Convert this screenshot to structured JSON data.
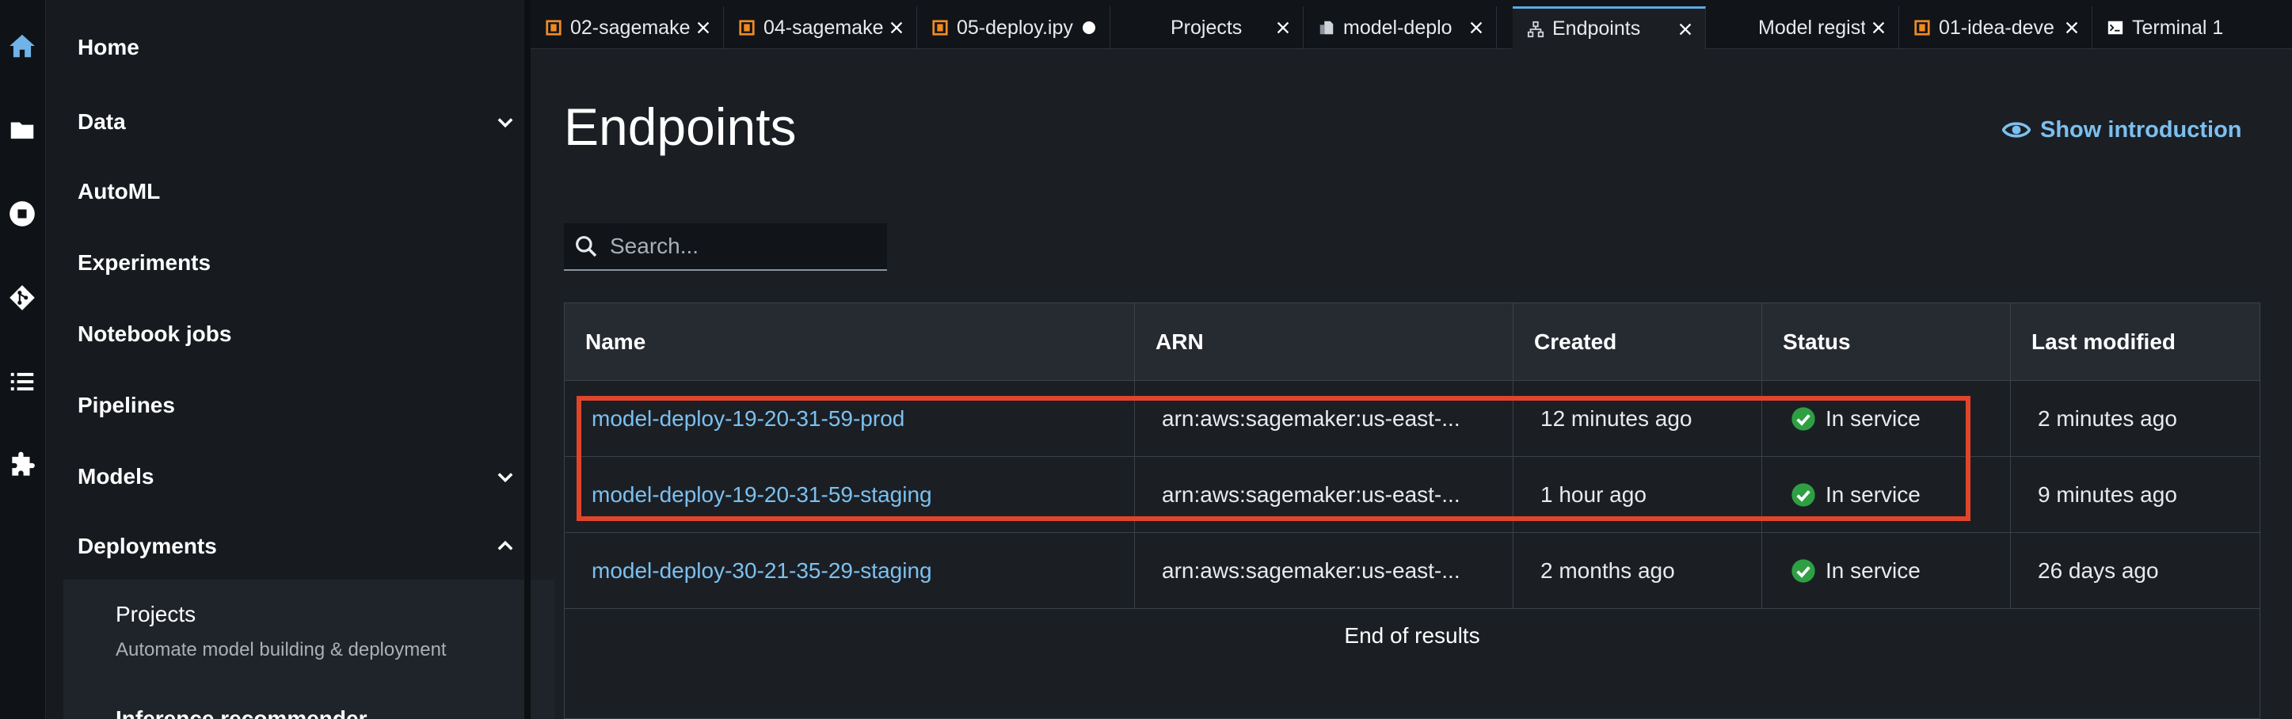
{
  "rail": {
    "icons": [
      "home-icon",
      "folder-icon",
      "stop-circle-icon",
      "git-icon",
      "list-icon",
      "extension-icon"
    ]
  },
  "sidebar": {
    "items": [
      {
        "label": "Home"
      },
      {
        "label": "Data"
      },
      {
        "label": "AutoML"
      },
      {
        "label": "Experiments"
      },
      {
        "label": "Notebook jobs"
      },
      {
        "label": "Pipelines"
      },
      {
        "label": "Models"
      },
      {
        "label": "Deployments"
      }
    ],
    "sub": {
      "title": "Projects",
      "description": "Automate model building & deployment",
      "next": "Inference recommender"
    }
  },
  "tabs": [
    {
      "label": "02-sagemake"
    },
    {
      "label": "04-sagemake"
    },
    {
      "label": "05-deploy.ipy"
    },
    {
      "label": "Projects"
    },
    {
      "label": "model-deplo"
    },
    {
      "label": "Endpoints"
    },
    {
      "label": "Model registr"
    },
    {
      "label": "01-idea-deve"
    },
    {
      "label": "Terminal 1"
    }
  ],
  "main": {
    "title": "Endpoints",
    "show_intro": "Show introduction",
    "search_placeholder": "Search..."
  },
  "table": {
    "columns": [
      "Name",
      "ARN",
      "Created",
      "Status",
      "Last modified"
    ],
    "rows": [
      {
        "name": "model-deploy-19-20-31-59-prod",
        "arn": "arn:aws:sagemaker:us-east-...",
        "created": "12 minutes ago",
        "status": "In service",
        "modified": "2 minutes ago"
      },
      {
        "name": "model-deploy-19-20-31-59-staging",
        "arn": "arn:aws:sagemaker:us-east-...",
        "created": "1 hour ago",
        "status": "In service",
        "modified": "9 minutes ago"
      },
      {
        "name": "model-deploy-30-21-35-29-staging",
        "arn": "arn:aws:sagemaker:us-east-...",
        "created": "2 months ago",
        "status": "In service",
        "modified": "26 days ago"
      }
    ],
    "footer": "End of results"
  },
  "colors": {
    "accent": "#7cc0f0",
    "status_ok": "#2ea043",
    "highlight": "#e0452b"
  }
}
